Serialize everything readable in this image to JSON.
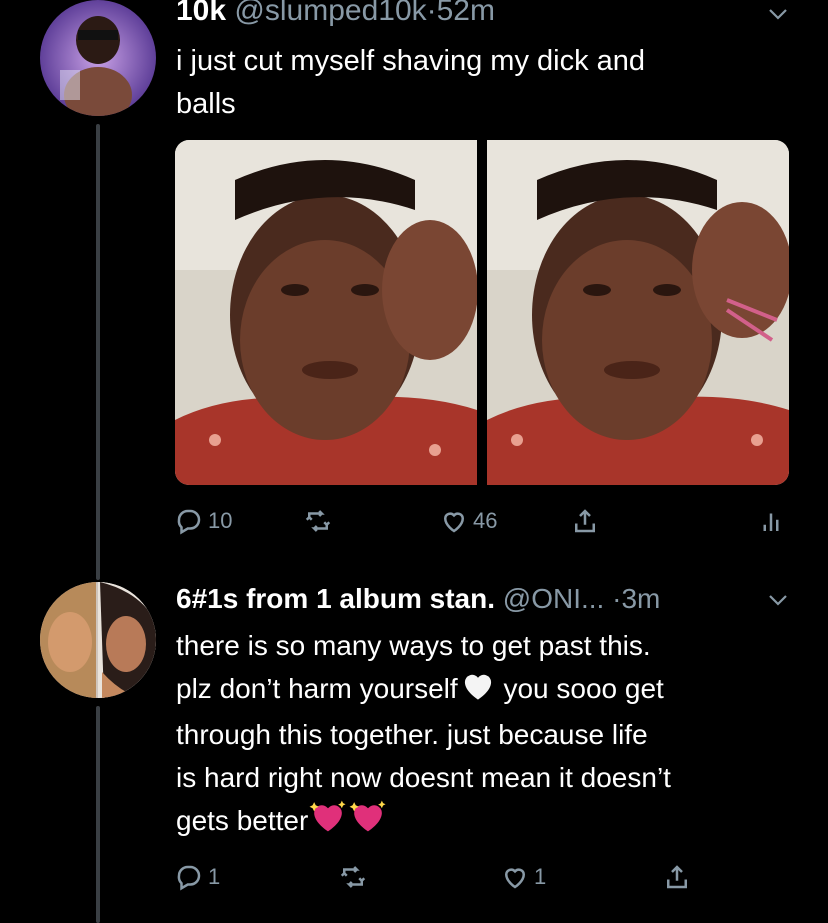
{
  "tweet1": {
    "name": "10k",
    "handle": "@slumped10k",
    "sep": "·",
    "time": "52m",
    "text_line1": "i just cut myself shaving my dick and",
    "text_line2": "balls",
    "replies": "10",
    "likes": "46"
  },
  "tweet2": {
    "name": "6#1s from 1 album stan.",
    "handle": "@ONI...",
    "sep": "·",
    "time": "3m",
    "lines": [
      "there is so many ways to get past this.",
      "plz don’t harm yourself",
      " you sooo get",
      "through this together. just because life",
      "is hard right now doesnt mean it doesn’t",
      "gets better"
    ],
    "replies": "1",
    "likes": "1"
  },
  "icons": {
    "reply": "reply-icon",
    "retweet": "retweet-icon",
    "like": "heart-icon",
    "share": "share-icon",
    "analytics": "analytics-icon",
    "more": "chevron-down-icon"
  },
  "colors": {
    "background": "#000000",
    "text": "#ffffff",
    "secondary": "#8899a6",
    "thread_line": "#3a3f44",
    "sparkle_heart": "#e0307a"
  }
}
